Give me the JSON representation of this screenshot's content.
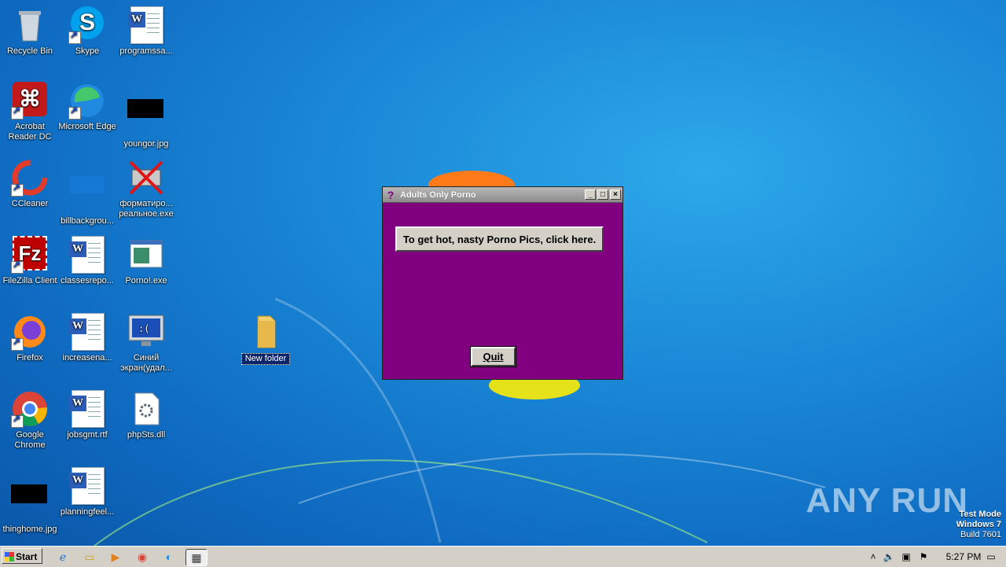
{
  "desktop": {
    "icons": [
      {
        "label": "Recycle Bin"
      },
      {
        "label": "Skype"
      },
      {
        "label": "programssa..."
      },
      {
        "label": "Acrobat Reader DC"
      },
      {
        "label": "Microsoft Edge"
      },
      {
        "label": "youngor.jpg"
      },
      {
        "label": "CCleaner"
      },
      {
        "label": "billbackgrou..."
      },
      {
        "label": "форматиро... реальное.exe"
      },
      {
        "label": "FileZilla Client"
      },
      {
        "label": "classesrepo..."
      },
      {
        "label": "Porno!.exe"
      },
      {
        "label": "Firefox"
      },
      {
        "label": "increasena..."
      },
      {
        "label": "Синий экран(удал..."
      },
      {
        "label": "Google Chrome"
      },
      {
        "label": "jobsgmt.rtf"
      },
      {
        "label": "phpSts.dll"
      },
      {
        "label": "thinghome.jpg"
      },
      {
        "label": "planningfeel..."
      },
      {
        "label": "New folder"
      }
    ]
  },
  "window": {
    "title": "Adults Only Porno",
    "main_button": "To get hot, nasty Porno Pics, click here.",
    "quit_button": "Quit",
    "bg_color": "#800080"
  },
  "taskbar": {
    "start_label": "Start",
    "clock": "5:27 PM"
  },
  "watermark": {
    "text": "ANY RUN"
  },
  "system_notice": {
    "line1": "Test Mode",
    "line2": "Windows 7",
    "line3": "Build 7601"
  }
}
